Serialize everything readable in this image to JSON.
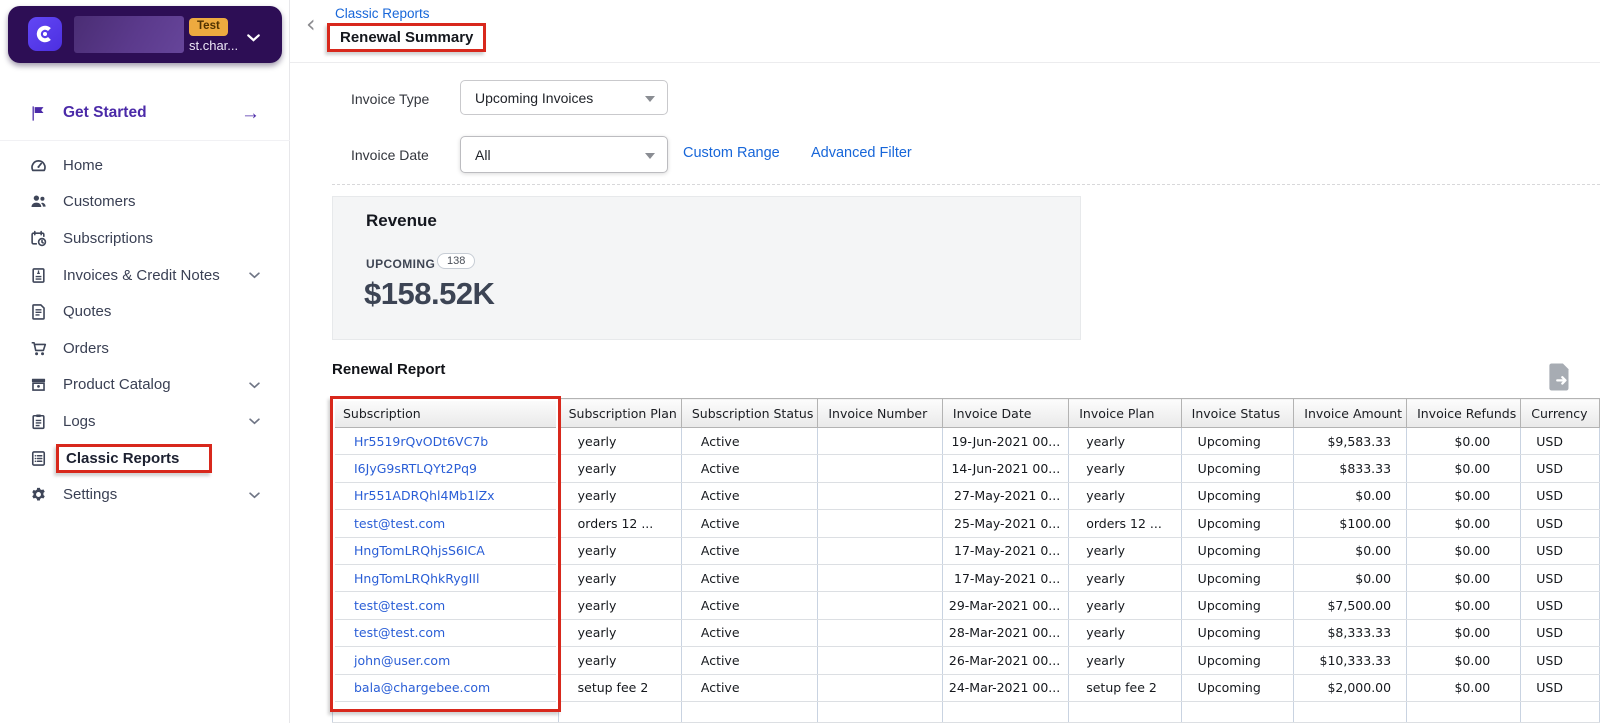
{
  "colors": {
    "annotation_red": "#d8281c",
    "brand_bg": "#2d0e55",
    "logo_purple": "#5336e8",
    "test_badge_bg": "#edaa3f",
    "link_blue": "#1766d9",
    "table_link_blue": "#2a5ed6",
    "get_started_purple": "#4b2aa8",
    "sidebar_text": "#3a4054",
    "revenue_amount_text": "#3c4454"
  },
  "sidebar": {
    "brand": {
      "badge": "Test",
      "domain": "st.char..."
    },
    "get_started_label": "Get Started",
    "items": [
      {
        "label": "Home",
        "icon": "dashboard",
        "chevron": false,
        "highlighted": false
      },
      {
        "label": "Customers",
        "icon": "customers",
        "chevron": false,
        "highlighted": false
      },
      {
        "label": "Subscriptions",
        "icon": "subscriptions",
        "chevron": false,
        "highlighted": false
      },
      {
        "label": "Invoices & Credit Notes",
        "icon": "invoices",
        "chevron": true,
        "highlighted": false
      },
      {
        "label": "Quotes",
        "icon": "quotes",
        "chevron": false,
        "highlighted": false
      },
      {
        "label": "Orders",
        "icon": "orders",
        "chevron": false,
        "highlighted": false
      },
      {
        "label": "Product Catalog",
        "icon": "catalog",
        "chevron": true,
        "highlighted": false
      },
      {
        "label": "Logs",
        "icon": "logs",
        "chevron": true,
        "highlighted": false
      },
      {
        "label": "Classic Reports",
        "icon": "reports",
        "chevron": false,
        "highlighted": true
      },
      {
        "label": "Settings",
        "icon": "settings",
        "chevron": true,
        "highlighted": false
      }
    ]
  },
  "header": {
    "breadcrumb": "Classic Reports",
    "title": "Renewal Summary"
  },
  "filters": {
    "invoice_type_label": "Invoice Type",
    "invoice_type_value": "Upcoming Invoices",
    "invoice_date_label": "Invoice Date",
    "invoice_date_value": "All",
    "custom_range_label": "Custom Range",
    "advanced_filter_label": "Advanced Filter"
  },
  "revenue": {
    "title": "Revenue",
    "upcoming_label": "UPCOMING",
    "count": "138",
    "amount": "$158.52K"
  },
  "report": {
    "title": "Renewal Report",
    "columns": [
      "Subscription",
      "Subscription Plan",
      "Subscription Status",
      "Invoice Number",
      "Invoice Date",
      "Invoice Plan",
      "Invoice Status",
      "Invoice Amount",
      "Invoice Refunds",
      "Currency"
    ],
    "rows": [
      [
        "Hr5519rQvODt6VC7b",
        "yearly",
        "Active",
        "",
        "19-Jun-2021 00...",
        "yearly",
        "Upcoming",
        "$9,583.33",
        "$0.00",
        "USD"
      ],
      [
        "I6JyG9sRTLQYt2Pq9",
        "yearly",
        "Active",
        "",
        "14-Jun-2021 00...",
        "yearly",
        "Upcoming",
        "$833.33",
        "$0.00",
        "USD"
      ],
      [
        "Hr551ADRQhl4Mb1lZx",
        "yearly",
        "Active",
        "",
        "27-May-2021 0...",
        "yearly",
        "Upcoming",
        "$0.00",
        "$0.00",
        "USD"
      ],
      [
        "test@test.com",
        "orders 12 ...",
        "Active",
        "",
        "25-May-2021 0...",
        "orders 12 ...",
        "Upcoming",
        "$100.00",
        "$0.00",
        "USD"
      ],
      [
        "HngTomLRQhjsS6ICA",
        "yearly",
        "Active",
        "",
        "17-May-2021 0...",
        "yearly",
        "Upcoming",
        "$0.00",
        "$0.00",
        "USD"
      ],
      [
        "HngTomLRQhkRygIIl",
        "yearly",
        "Active",
        "",
        "17-May-2021 0...",
        "yearly",
        "Upcoming",
        "$0.00",
        "$0.00",
        "USD"
      ],
      [
        "test@test.com",
        "yearly",
        "Active",
        "",
        "29-Mar-2021 00...",
        "yearly",
        "Upcoming",
        "$7,500.00",
        "$0.00",
        "USD"
      ],
      [
        "test@test.com",
        "yearly",
        "Active",
        "",
        "28-Mar-2021 00...",
        "yearly",
        "Upcoming",
        "$8,333.33",
        "$0.00",
        "USD"
      ],
      [
        "john@user.com",
        "yearly",
        "Active",
        "",
        "26-Mar-2021 00...",
        "yearly",
        "Upcoming",
        "$10,333.33",
        "$0.00",
        "USD"
      ],
      [
        "bala@chargebee.com",
        "setup fee 2",
        "Active",
        "",
        "24-Mar-2021 00...",
        "setup fee 2",
        "Upcoming",
        "$2,000.00",
        "$0.00",
        "USD"
      ]
    ]
  }
}
